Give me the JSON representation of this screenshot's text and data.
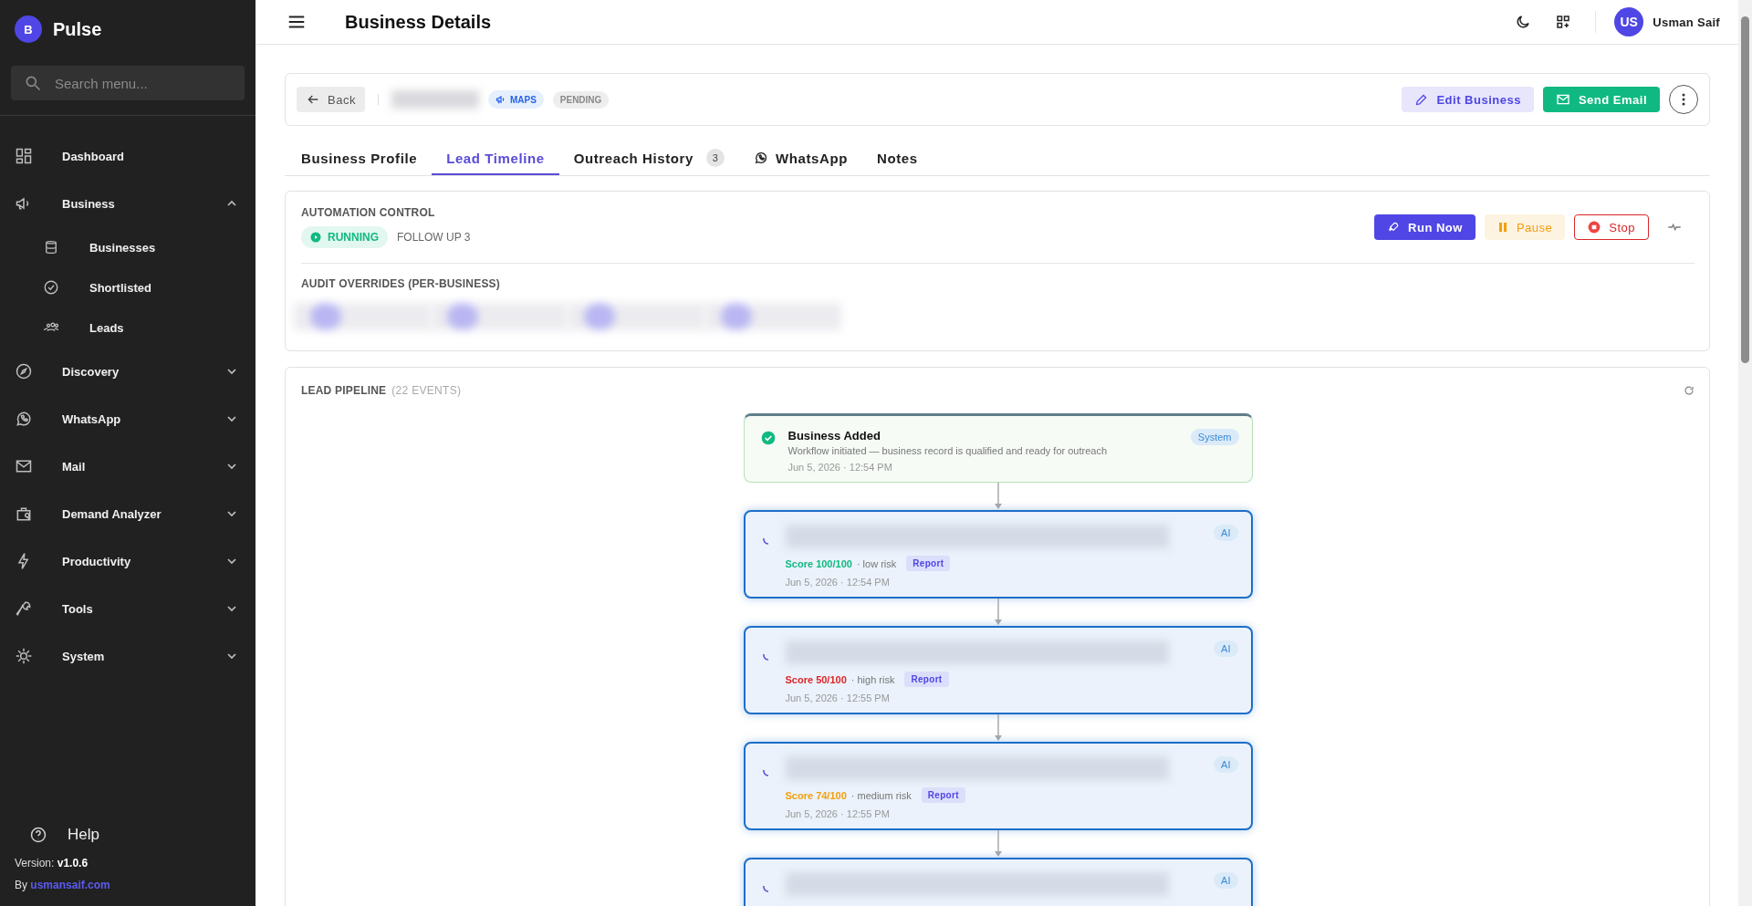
{
  "sidebar": {
    "logo_letter": "B",
    "app_name": "Pulse",
    "search": {
      "placeholder": "Search menu..."
    },
    "items": [
      {
        "label": "Dashboard"
      },
      {
        "label": "Business",
        "expanded": true,
        "children": [
          {
            "label": "Businesses"
          },
          {
            "label": "Shortlisted"
          },
          {
            "label": "Leads"
          }
        ]
      },
      {
        "label": "Discovery",
        "expanded": false
      },
      {
        "label": "WhatsApp",
        "expanded": false
      },
      {
        "label": "Mail",
        "expanded": false
      },
      {
        "label": "Demand Analyzer",
        "expanded": false
      },
      {
        "label": "Productivity",
        "expanded": false
      },
      {
        "label": "Tools",
        "expanded": false
      },
      {
        "label": "System",
        "expanded": false
      }
    ],
    "help": "Help",
    "version_label": "Version:",
    "version": "v1.0.6",
    "by_label": "By",
    "by_link": "usmansaif.com"
  },
  "header": {
    "title": "Business Details",
    "user_initials": "US",
    "user_name": "Usman Saif"
  },
  "toolbar": {
    "back": "Back",
    "source_tag": "MAPS",
    "status_tag": "PENDING",
    "edit": "Edit Business",
    "send": "Send Email"
  },
  "tabs": [
    {
      "label": "Business Profile",
      "selected": false
    },
    {
      "label": "Lead Timeline",
      "selected": true
    },
    {
      "label": "Outreach History",
      "selected": false,
      "count": "3"
    },
    {
      "label": "WhatsApp",
      "selected": false
    },
    {
      "label": "Notes",
      "selected": false
    }
  ],
  "automation": {
    "heading": "AUTOMATION CONTROL",
    "state": "RUNNING",
    "step": "FOLLOW UP 3",
    "run": "Run Now",
    "pause": "Pause",
    "stop": "Stop",
    "overrides_heading": "AUDIT OVERRIDES (PER-BUSINESS)"
  },
  "pipeline": {
    "heading": "LEAD PIPELINE",
    "count": "(22 EVENTS)",
    "events": [
      {
        "kind": "system",
        "title": "Business Added",
        "description": "Workflow initiated — business record is qualified and ready for outreach",
        "time": "Jun 5, 2026 · 12:54 PM",
        "badge": "System"
      },
      {
        "kind": "ai",
        "badge": "AI",
        "score": "Score 100/100",
        "color": "#10b981",
        "risk": "· low risk",
        "report": "Report",
        "time": "Jun 5, 2026 · 12:54 PM"
      },
      {
        "kind": "ai",
        "badge": "AI",
        "score": "Score 50/100",
        "color": "#dc2626",
        "risk": "· high risk",
        "report": "Report",
        "time": "Jun 5, 2026 · 12:55 PM"
      },
      {
        "kind": "ai",
        "badge": "AI",
        "score": "Score 74/100",
        "color": "#f59e0b",
        "risk": "· medium risk",
        "report": "Report",
        "time": "Jun 5, 2026 · 12:55 PM"
      },
      {
        "kind": "ai",
        "badge": "AI"
      }
    ]
  }
}
